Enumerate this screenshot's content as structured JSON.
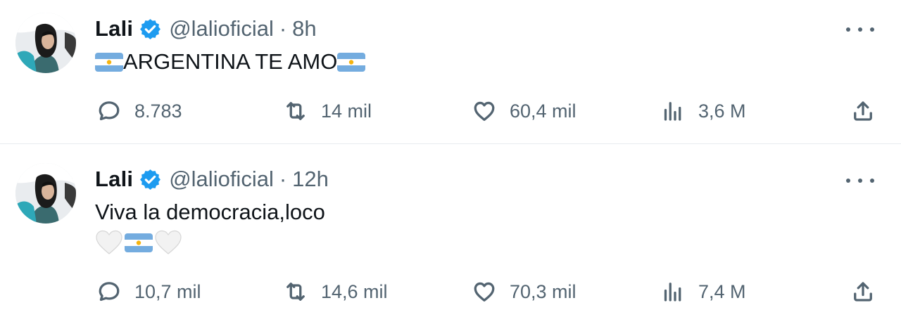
{
  "colors": {
    "verified": "#1d9bf0",
    "muted": "#536471",
    "text": "#0f1419",
    "flag_blue": "#74acdf",
    "sun": "#f6b40e"
  },
  "tweets": [
    {
      "name": "Lali",
      "handle": "@lalioficial",
      "separator": "·",
      "time": "8h",
      "text": "ARGENTINA TE AMO",
      "text_emoji": [
        "argentina-flag",
        "argentina-flag"
      ],
      "stats": {
        "replies": "8.783",
        "reposts": "14 mil",
        "likes": "60,4 mil",
        "views": "3,6 M"
      }
    },
    {
      "name": "Lali",
      "handle": "@lalioficial",
      "separator": "·",
      "time": "12h",
      "text": "Viva la democracia,loco",
      "text_emoji": [
        "white-heart",
        "argentina-flag",
        "white-heart"
      ],
      "stats": {
        "replies": "10,7 mil",
        "reposts": "14,6 mil",
        "likes": "70,3 mil",
        "views": "7,4 M"
      }
    }
  ],
  "icons": {
    "reply": "speech-bubble-icon",
    "repost": "repost-arrows-icon",
    "like": "heart-outline-icon",
    "views": "bar-chart-icon",
    "share": "share-upload-icon",
    "more": "more-dots-icon",
    "verified": "verified-badge-icon"
  }
}
